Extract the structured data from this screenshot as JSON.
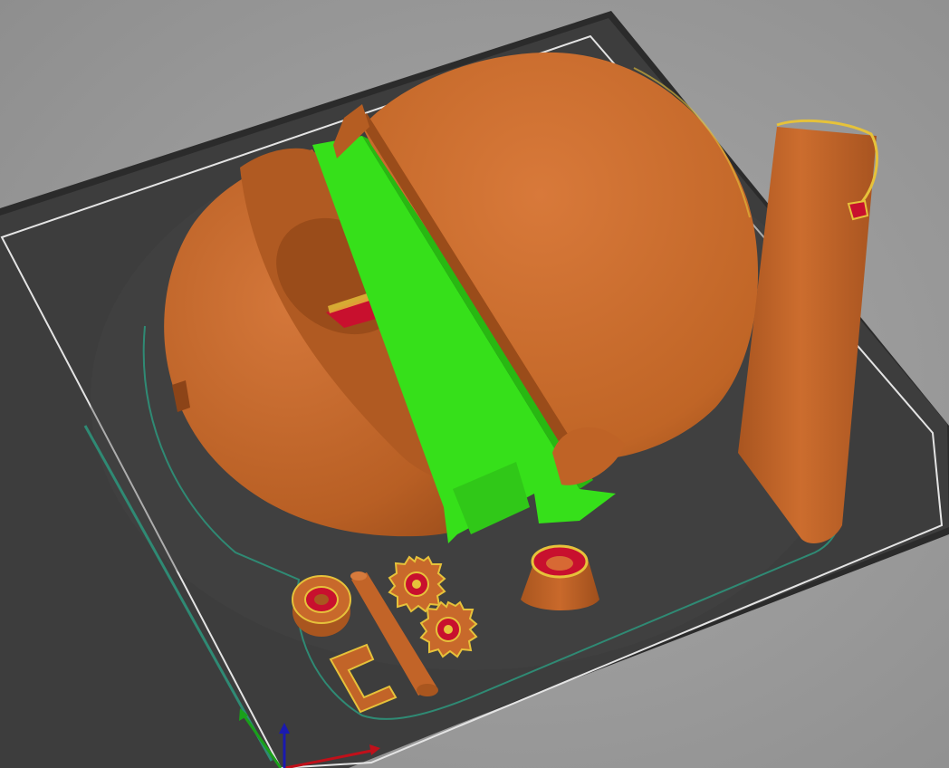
{
  "app": {
    "view": "slicer-preview"
  },
  "scene": {
    "objects": [
      "dome-half-left",
      "dome-half-right",
      "support-structures",
      "half-cylinder-shell",
      "cone-knob",
      "gear",
      "gear",
      "ring-disc",
      "rod-pin",
      "bracket-clip"
    ]
  },
  "colors": {
    "background": "#999999",
    "bed_surface": "#3c3c3c",
    "bed_edge": "#2a2a2a",
    "bed_border": "#e8e8e8",
    "perimeter": "#c86a2a",
    "perimeter_dark": "#9a4e1c",
    "support": "#36e01a",
    "infill": "#c8102e",
    "solid_top": "#e6c23a",
    "skirt": "#2f8a74",
    "axis_x": "#c0101a",
    "axis_y": "#1aa01a",
    "axis_z": "#1a1ab0"
  },
  "axes": {
    "x": "x-axis",
    "y": "y-axis",
    "z": "z-axis"
  }
}
